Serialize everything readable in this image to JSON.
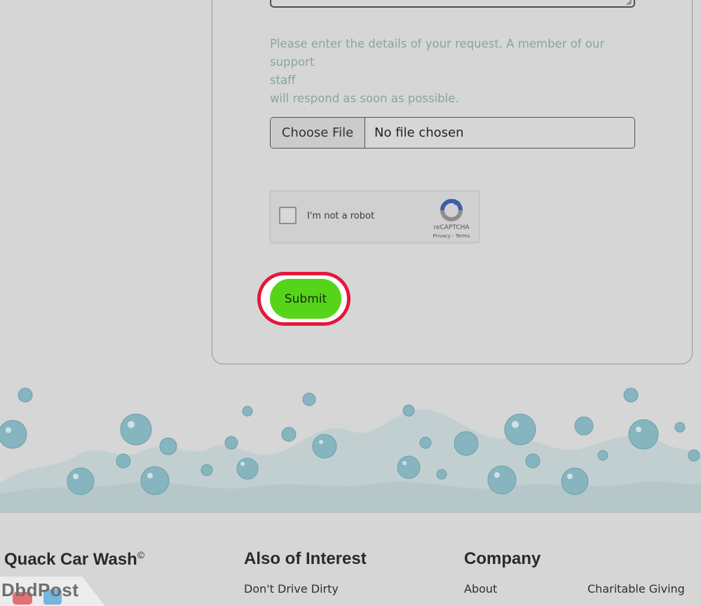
{
  "form": {
    "help_line1": "Please enter the details of your request. A member of our support",
    "help_line2": "staff",
    "help_line3": "will respond as soon as possible.",
    "file_button": "Choose File",
    "file_status": "No file chosen",
    "captcha_label": "I'm not a robot",
    "captcha_brand": "reCAPTCHA",
    "captcha_links": "Privacy - Terms",
    "submit_label": "Submit"
  },
  "footer": {
    "brand": "Quack Car Wash",
    "brand_mark": "©",
    "col2_title": "Also of Interest",
    "col2_link": "Don't Drive Dirty",
    "col3_title": "Company",
    "col3_link1": "About",
    "col3_link2": "Charitable Giving"
  },
  "watermark": {
    "text": "DbdPost"
  },
  "colors": {
    "background": "#d6d6d6",
    "submit": "#56d41a",
    "highlight_ring": "#e5183a",
    "help_text": "#8aa3a3",
    "bubbles": "#7fb3bd"
  },
  "icons": [
    "resize-grip-icon",
    "recaptcha-logo-icon",
    "youtube-icon",
    "twitter-icon"
  ]
}
